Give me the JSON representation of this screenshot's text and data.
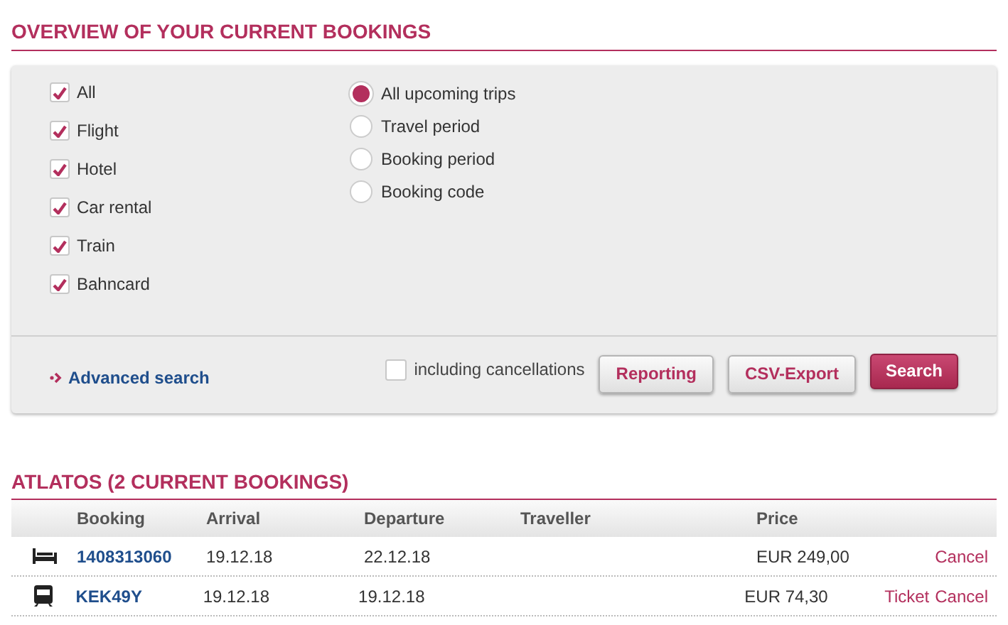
{
  "title": "OVERVIEW OF YOUR CURRENT BOOKINGS",
  "filters": {
    "types": [
      {
        "label": "All",
        "checked": true
      },
      {
        "label": "Flight",
        "checked": true
      },
      {
        "label": "Hotel",
        "checked": true
      },
      {
        "label": "Car rental",
        "checked": true
      },
      {
        "label": "Train",
        "checked": true
      },
      {
        "label": "Bahncard",
        "checked": true
      }
    ],
    "periods": [
      {
        "label": "All upcoming trips",
        "selected": true
      },
      {
        "label": "Travel period",
        "selected": false
      },
      {
        "label": "Booking period",
        "selected": false
      },
      {
        "label": "Booking code",
        "selected": false
      }
    ],
    "advanced_search": "Advanced search",
    "include_cancellations": {
      "label": "including cancellations",
      "checked": false
    },
    "buttons": [
      {
        "label": "Reporting",
        "kind": "secondary"
      },
      {
        "label": "CSV-Export",
        "kind": "secondary"
      },
      {
        "label": "Search",
        "kind": "primary"
      }
    ]
  },
  "section": {
    "title": "ATLATOS (2 CURRENT BOOKINGS)",
    "columns": [
      "Booking",
      "Arrival",
      "Departure",
      "Traveller",
      "Price"
    ],
    "rows": [
      {
        "kind": "hotel",
        "booking": "1408313060",
        "arrival": "19.12.18",
        "departure": "22.12.18",
        "price": "EUR 249,00",
        "actions": [
          "Cancel"
        ]
      },
      {
        "kind": "train",
        "booking": "KEK49Y",
        "arrival": "19.12.18",
        "departure": "19.12.18",
        "price": "EUR 74,30",
        "actions": [
          "Ticket",
          "Cancel"
        ]
      }
    ]
  }
}
